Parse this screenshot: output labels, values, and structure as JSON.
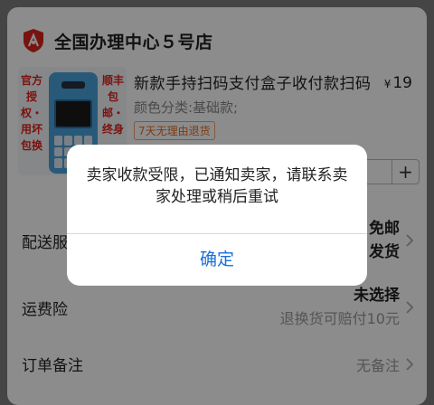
{
  "store": {
    "logo_icon": "store-logo-icon",
    "name": "全国办理中心５号店"
  },
  "product": {
    "thumb_left_text": "官方授权・用坏包换",
    "thumb_right_text": "顺丰包邮・终身",
    "title": "新款手持扫码支付盒子收付款扫码",
    "currency": "¥",
    "price": "19",
    "spec": "颜色分类:基础款;",
    "tag": "7天无理由退货",
    "stepper_plus": "+"
  },
  "shipping": {
    "label": "配送服",
    "value_line1": "免邮",
    "value_line2": "发货"
  },
  "insurance": {
    "label": "运费险",
    "value_line1": "未选择",
    "value_line2": "退换货可赔付10元"
  },
  "note": {
    "label": "订单备注",
    "value": "无备注"
  },
  "dialog": {
    "message": "卖家收款受限，已通知卖家，请联系卖家处理或稍后重试",
    "confirm_label": "确定"
  },
  "colors": {
    "accent_blue": "#1a6fd8",
    "tag_orange": "#e86a1c",
    "brand_red": "#e0221b"
  }
}
